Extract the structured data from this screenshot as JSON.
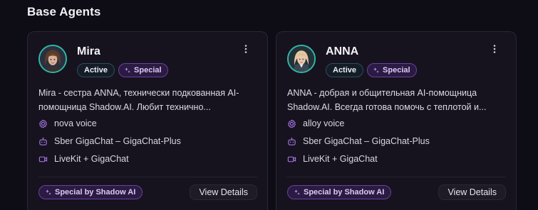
{
  "section": {
    "title": "Base Agents"
  },
  "agents": [
    {
      "name": "Mira",
      "status_badge": "Active",
      "tag_badge": "Special",
      "description": "Mira - сестра ANNA, технически подкованная AI-помощница Shadow.AI. Любит технично...",
      "voice": "nova voice",
      "model": "Sber GigaChat – GigaChat-Plus",
      "stack": "LiveKit + GigaChat",
      "footer_badge": "Special by Shadow AI",
      "view_button": "View Details"
    },
    {
      "name": "ANNA",
      "status_badge": "Active",
      "tag_badge": "Special",
      "description": "ANNA - добрая и общительная AI-помощница Shadow.AI. Всегда готова помочь с теплотой и...",
      "voice": "alloy voice",
      "model": "Sber GigaChat – GigaChat-Plus",
      "stack": "LiveKit + GigaChat",
      "footer_badge": "Special by Shadow AI",
      "view_button": "View Details"
    }
  ],
  "icons": {
    "menu": "kebab-icon",
    "special": "sparkles-icon",
    "voice": "gear-icon",
    "model": "bot-icon",
    "stack": "video-icon"
  },
  "colors": {
    "background": "#0e0c14",
    "card": "#16131f",
    "accent_purple": "#a978e8",
    "avatar_ring": "#2fb9a6"
  }
}
